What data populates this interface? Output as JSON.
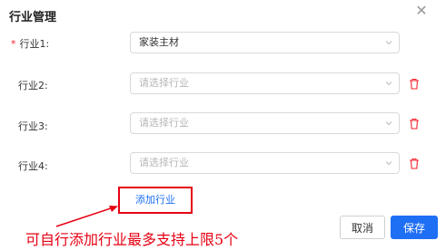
{
  "dialog": {
    "title": "行业管理"
  },
  "rows": [
    {
      "label": "行业1:",
      "value": "家装主材",
      "required": true
    },
    {
      "label": "行业2:",
      "placeholder": "请选择行业"
    },
    {
      "label": "行业3:",
      "placeholder": "请选择行业"
    },
    {
      "label": "行业4:",
      "placeholder": "请选择行业"
    }
  ],
  "add_label": "添加行业",
  "annotation": "可自行添加行业最多支持上限5个",
  "buttons": {
    "cancel": "取消",
    "save": "保存"
  },
  "colors": {
    "primary": "#1f6ff5",
    "danger": "#f5222d",
    "annotation": "#e60012"
  }
}
